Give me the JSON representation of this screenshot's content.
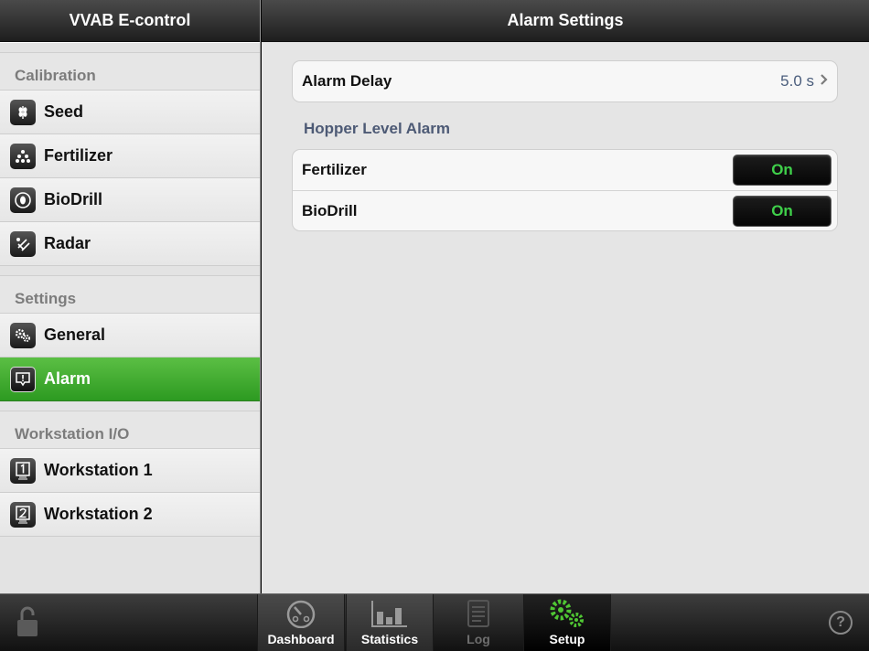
{
  "sidebar": {
    "title": "VVAB E-control",
    "sections": [
      {
        "title": "Calibration",
        "items": [
          "Seed",
          "Fertilizer",
          "BioDrill",
          "Radar"
        ]
      },
      {
        "title": "Settings",
        "items": [
          "General",
          "Alarm"
        ]
      },
      {
        "title": "Workstation I/O",
        "items": [
          "Workstation 1",
          "Workstation 2"
        ]
      }
    ],
    "active_item": "Alarm"
  },
  "main": {
    "title": "Alarm Settings",
    "alarm_delay": {
      "label": "Alarm Delay",
      "value": "5.0 s"
    },
    "hopper_level_alarm": {
      "title": "Hopper Level Alarm",
      "rows": [
        {
          "label": "Fertilizer",
          "state": "On"
        },
        {
          "label": "BioDrill",
          "state": "On"
        }
      ]
    }
  },
  "tabbar": {
    "tabs": [
      {
        "label": "Dashboard",
        "icon": "dashboard-gauge-icon"
      },
      {
        "label": "Statistics",
        "icon": "statistics-bars-icon"
      },
      {
        "label": "Log",
        "icon": "log-document-icon"
      },
      {
        "label": "Setup",
        "icon": "setup-gears-icon"
      }
    ],
    "selected": "Setup",
    "help_glyph": "?"
  },
  "colors": {
    "active_green": "#3fa32e",
    "toggle_on_text": "#3fd04a",
    "setup_icon_green": "#4fc633",
    "value_blue": "#4a5d7c"
  }
}
